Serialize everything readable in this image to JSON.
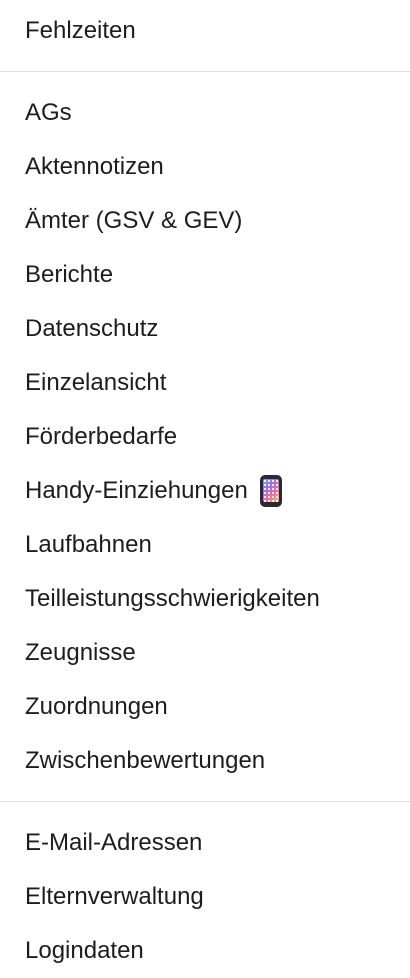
{
  "menu": {
    "group1": [
      "Fehlzeiten"
    ],
    "group2": [
      "AGs",
      "Aktennotizen",
      "Ämter (GSV & GEV)",
      "Berichte",
      "Datenschutz",
      "Einzelansicht",
      "Förderbedarfe",
      "Handy-Einziehungen",
      "Laufbahnen",
      "Teilleistungsschwierigkeiten",
      "Zeugnisse",
      "Zuordnungen",
      "Zwischenbewertungen"
    ],
    "group3": [
      "E-Mail-Adressen",
      "Elternverwaltung",
      "Logindaten"
    ],
    "handy_icon": "mobile-phone-icon"
  }
}
